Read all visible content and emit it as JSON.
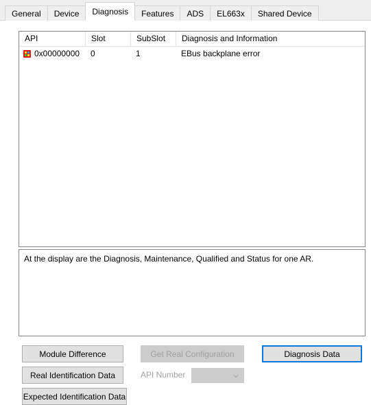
{
  "tabs": [
    {
      "label": "General",
      "selected": false
    },
    {
      "label": "Device",
      "selected": false
    },
    {
      "label": "Diagnosis",
      "selected": true
    },
    {
      "label": "Features",
      "selected": false
    },
    {
      "label": "ADS",
      "selected": false
    },
    {
      "label": "EL663x",
      "selected": false
    },
    {
      "label": "Shared Device",
      "selected": false
    }
  ],
  "diagnosis_list": {
    "columns": [
      "API",
      "Slot",
      "SubSlot",
      "Diagnosis and Information"
    ],
    "rows": [
      {
        "icon": "module-error-icon",
        "api": "0x00000000",
        "slot": "0",
        "subslot": "1",
        "diagnosis": "EBus backplane error"
      }
    ]
  },
  "description": {
    "text": "At the display are the Diagnosis, Maintenance, Qualified and Status for one AR."
  },
  "buttons": {
    "module_difference": "Module Difference",
    "real_identification_data": "Real Identification Data",
    "expected_identification_data": "Expected Identification Data",
    "get_real_configuration": "Get Real Configuration",
    "diagnosis_data": "Diagnosis Data"
  },
  "api_number": {
    "label": "API Number",
    "value": "",
    "icon": "chevron-down-icon"
  },
  "colors": {
    "focus_border": "#0078D7",
    "error_icon": "#E11515",
    "disabled_text": "#A0A0A0",
    "tab_strip": "#EFEFEF"
  }
}
